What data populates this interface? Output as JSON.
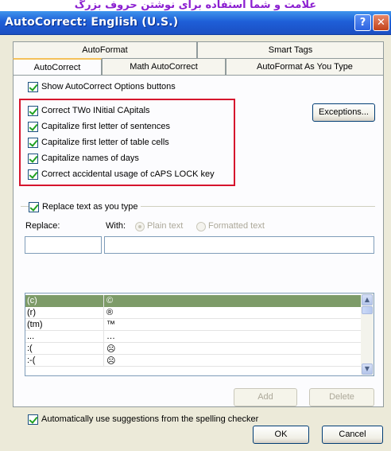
{
  "caption": "علامت و شما استفاده برای نوشتن حروف بزرگ",
  "window": {
    "title": "AutoCorrect: English (U.S.)",
    "help_label": "?",
    "close_label": "✕"
  },
  "tabs": {
    "row1": [
      "AutoFormat",
      "Smart Tags"
    ],
    "row2": [
      "AutoCorrect",
      "Math AutoCorrect",
      "AutoFormat As You Type"
    ],
    "active": "AutoCorrect"
  },
  "options": {
    "show_buttons": "Show AutoCorrect Options buttons",
    "two_initial": "Correct TWo INitial CApitals",
    "cap_sentences": "Capitalize first letter of sentences",
    "cap_table": "Capitalize first letter of table cells",
    "cap_days": "Capitalize names of days",
    "caps_lock": "Correct accidental usage of cAPS LOCK key",
    "exceptions_label": "Exceptions..."
  },
  "replace": {
    "checkbox_label": "Replace text as you type",
    "replace_label": "Replace:",
    "with_label": "With:",
    "plain_text": "Plain text",
    "formatted_text": "Formatted text",
    "replace_value": "",
    "with_value": ""
  },
  "entries": [
    {
      "from": "(c)",
      "to": "©"
    },
    {
      "from": "(r)",
      "to": "®"
    },
    {
      "from": "(tm)",
      "to": "™"
    },
    {
      "from": "...",
      "to": "…"
    },
    {
      "from": ":(",
      "to": "☹"
    },
    {
      "from": ":-(",
      "to": "☹"
    }
  ],
  "buttons": {
    "add": "Add",
    "delete": "Delete",
    "ok": "OK",
    "cancel": "Cancel"
  },
  "spelling": {
    "label": "Automatically use suggestions from the spelling checker"
  },
  "colors": {
    "titlebar": "#1e5fd8",
    "selected_row": "#7d9b68",
    "highlight_border": "#d6142d",
    "check": "#21a121"
  }
}
